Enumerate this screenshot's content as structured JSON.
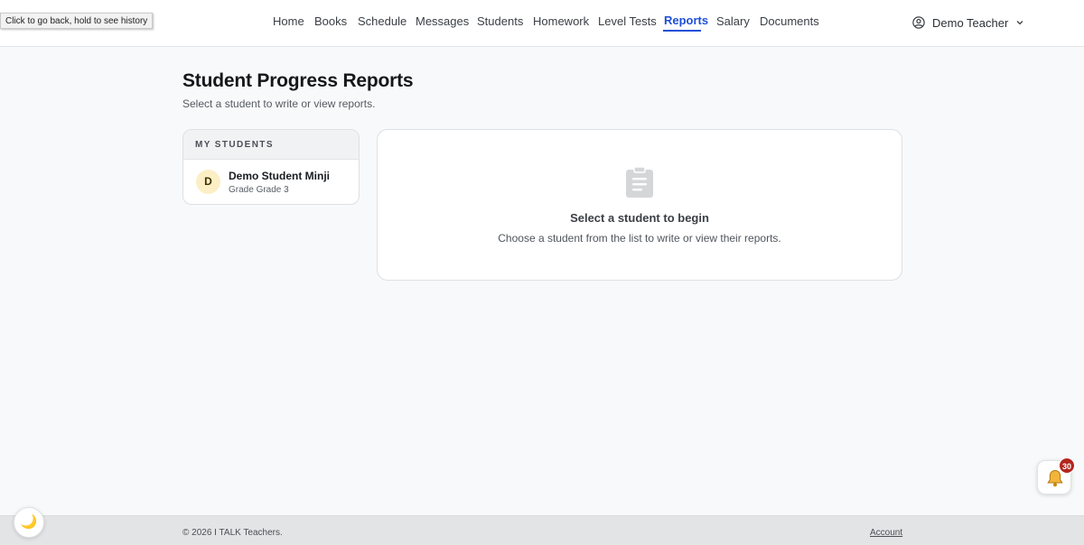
{
  "browser_tooltip": "Click to go back, hold to see history",
  "nav": {
    "items": [
      {
        "label": "Home",
        "active": false
      },
      {
        "label": "Books",
        "active": false
      },
      {
        "label": "Schedule",
        "active": false
      },
      {
        "label": "Messages",
        "active": false
      },
      {
        "label": "Students",
        "active": false
      },
      {
        "label": "Homework",
        "active": false
      },
      {
        "label": "Level Tests",
        "active": false
      },
      {
        "label": "Reports",
        "active": true
      },
      {
        "label": "Salary",
        "active": false
      },
      {
        "label": "Documents",
        "active": false
      }
    ],
    "user_name": "Demo Teacher"
  },
  "page": {
    "title": "Student Progress Reports",
    "subtitle": "Select a student to write or view reports."
  },
  "students_panel": {
    "header": "MY STUDENTS",
    "students": [
      {
        "initial": "D",
        "name": "Demo Student Minji",
        "grade": "Grade Grade 3"
      }
    ]
  },
  "detail_panel": {
    "icon": "clipboard-icon",
    "title": "Select a student to begin",
    "description": "Choose a student from the list to write or view their reports."
  },
  "footer": {
    "copyright": "© 2026 I TALK Teachers.",
    "account_link": "Account"
  },
  "notifications": {
    "count": "30"
  },
  "colors": {
    "accent": "#1d4fd8",
    "badge": "#b3261e",
    "avatar_bg": "#fcefc5"
  }
}
